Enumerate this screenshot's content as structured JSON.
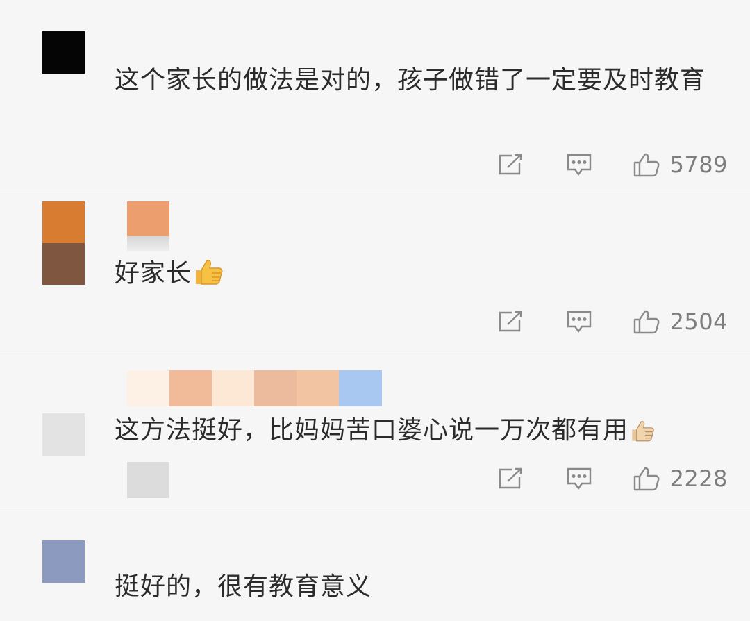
{
  "colors": {
    "background": "#f6f6f6",
    "divider": "#e6e6e6",
    "icon": "#8a8a8a",
    "text": "#2b2b2b",
    "count": "#7d7d7d"
  },
  "comments": [
    {
      "text": "这个家长的做法是对的，孩子做错了一定要及时教育",
      "emoji": "",
      "like_count": "5789",
      "avatar_colors": [
        "#050505"
      ]
    },
    {
      "text": "好家长",
      "emoji": "thumbs-up-emoji",
      "like_count": "2504",
      "avatar_colors": [
        "#d87c32",
        "#7f5640"
      ]
    },
    {
      "text": "这方法挺好，比妈妈苦口婆心说一万次都有用",
      "emoji": "thumbs-up-emoji",
      "like_count": "2228",
      "avatar_colors": [
        "#e3e3e3"
      ]
    },
    {
      "text": "挺好的，很有教育意义",
      "emoji": "",
      "like_count": "",
      "avatar_colors": [
        "#8c9abf"
      ]
    }
  ],
  "icons": {
    "share": "share-icon",
    "reply": "comment-icon",
    "like": "like-icon"
  }
}
